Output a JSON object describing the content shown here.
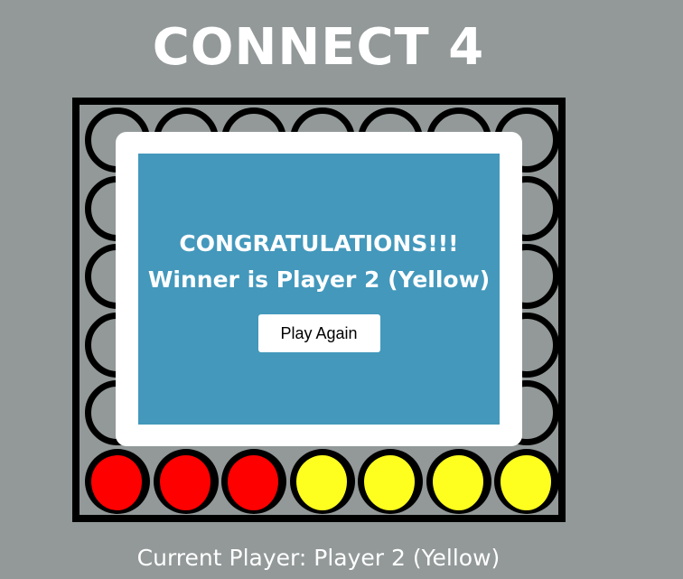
{
  "game": {
    "title": "CONNECT 4"
  },
  "board": {
    "columns": 7,
    "rows": 6,
    "bottom_row": [
      "red",
      "red",
      "red",
      "yellow",
      "yellow",
      "yellow",
      "yellow"
    ],
    "colors": {
      "red": "#ff0000",
      "yellow": "#ffff1f",
      "frame": "#000000"
    }
  },
  "modal": {
    "line1": "CONGRATULATIONS!!!",
    "line2": "Winner is Player 2 (Yellow)",
    "play_again_label": "Play Again",
    "panel_color": "#4398bc"
  },
  "status": {
    "current_player": "Current Player: Player 2 (Yellow)"
  },
  "theme": {
    "background": "#929998"
  }
}
